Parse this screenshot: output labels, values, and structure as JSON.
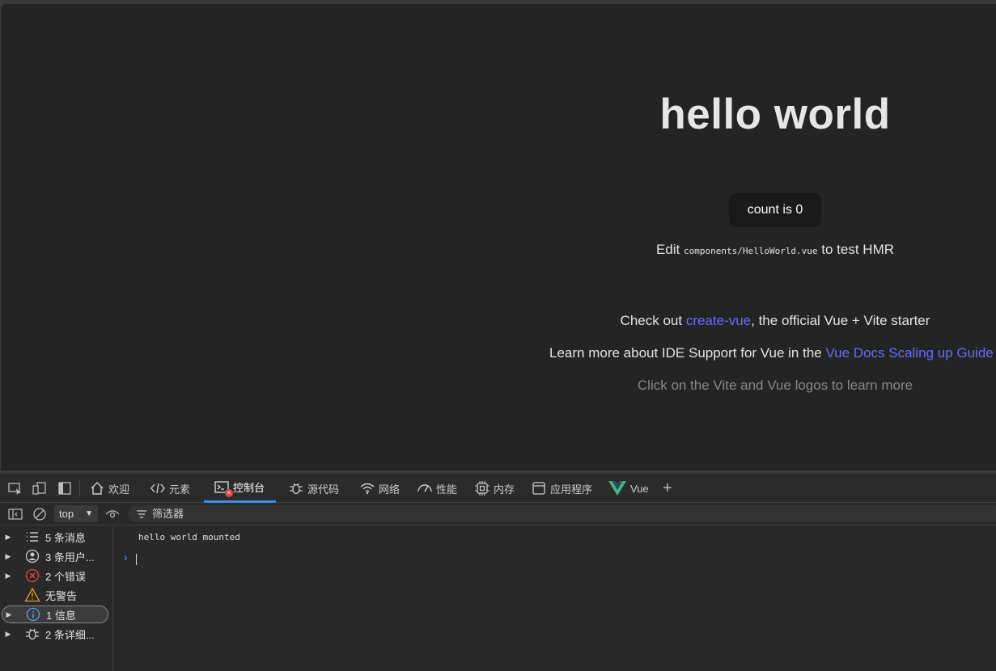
{
  "page": {
    "title": "hello world",
    "count_button": "count is 0",
    "edit_prefix": "Edit ",
    "edit_code": "components/HelloWorld.vue",
    "edit_suffix": " to test HMR",
    "check_prefix": "Check out ",
    "check_link": "create-vue",
    "check_suffix": ", the official Vue + Vite starter",
    "learn_prefix": "Learn more about IDE Support for Vue in the ",
    "learn_link": "Vue Docs Scaling up Guide",
    "click_text": "Click on the Vite and Vue logos to learn more",
    "link_color": "#646cff"
  },
  "devtools": {
    "tabs": [
      {
        "label": "欢迎",
        "icon": "home-icon"
      },
      {
        "label": "元素",
        "icon": "code-icon"
      },
      {
        "label": "控制台",
        "icon": "console-icon",
        "active": true
      },
      {
        "label": "源代码",
        "icon": "bug-icon"
      },
      {
        "label": "网络",
        "icon": "wifi-icon"
      },
      {
        "label": "性能",
        "icon": "gauge-icon"
      },
      {
        "label": "内存",
        "icon": "chip-icon"
      },
      {
        "label": "应用程序",
        "icon": "app-icon"
      },
      {
        "label": "Vue",
        "icon": "vue-icon"
      }
    ],
    "add_tab": "+",
    "accent": "#3c8ee6",
    "context": "top",
    "filter_placeholder": "筛选器",
    "sidebar": [
      {
        "label": "5 条消息",
        "icon": "list-icon"
      },
      {
        "label": "3 条用户...",
        "icon": "user-icon"
      },
      {
        "label": "2 个错误",
        "icon": "error-icon"
      },
      {
        "label": "无警告",
        "icon": "warning-icon"
      },
      {
        "label": "1 信息",
        "icon": "info-icon",
        "selected": true
      },
      {
        "label": "2 条详细...",
        "icon": "bug-icon"
      }
    ],
    "log": "hello world mounted",
    "prompt": "›"
  }
}
